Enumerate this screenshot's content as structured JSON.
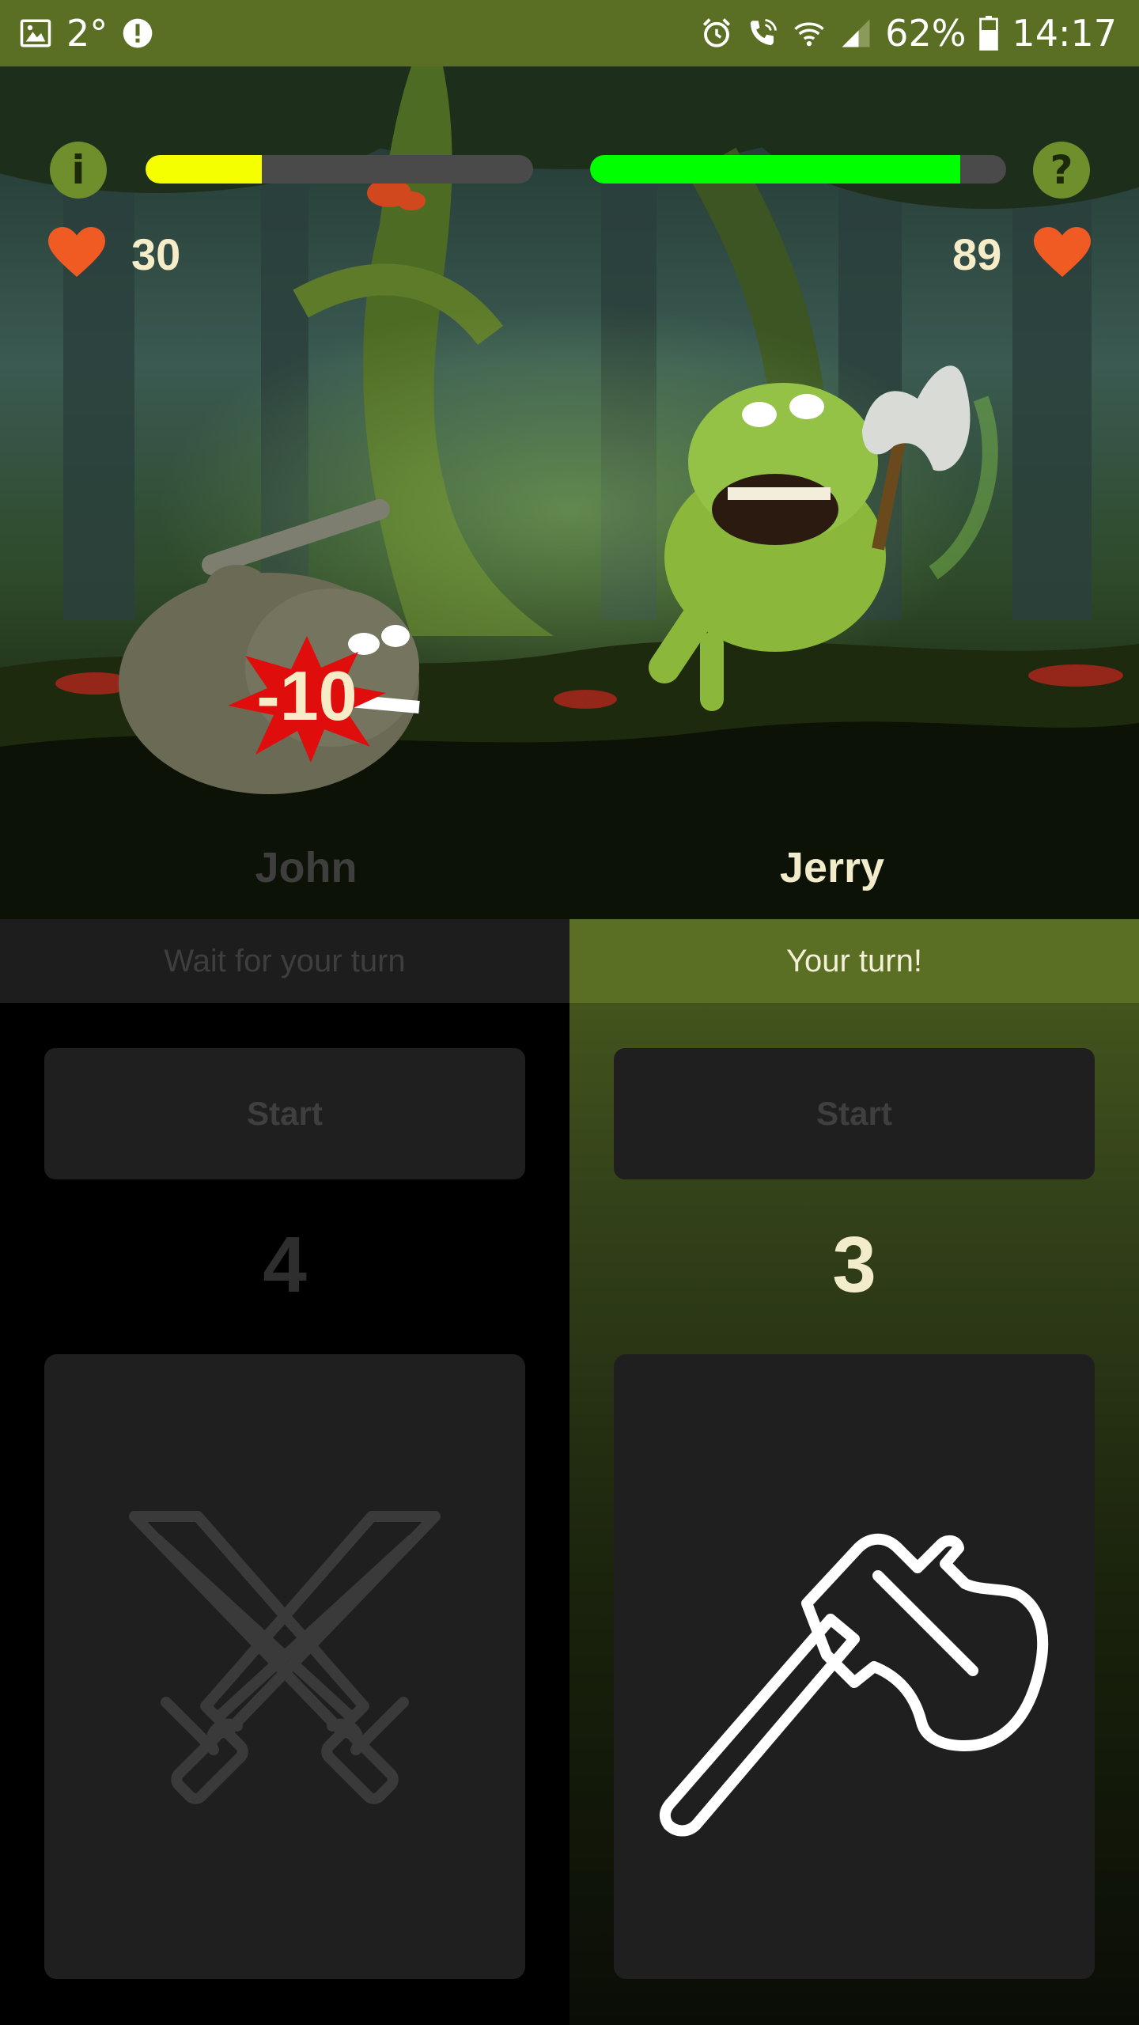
{
  "statusbar": {
    "temperature": "2°",
    "battery": "62%",
    "time": "14:17",
    "icons": [
      "image-icon",
      "alert-icon",
      "alarm-icon",
      "wifi-call-icon",
      "wifi-icon",
      "signal-icon",
      "battery-icon"
    ]
  },
  "hud": {
    "info_button": "i",
    "help_button": "?",
    "left_player": {
      "hp": "30",
      "hp_fraction": 0.3,
      "name": "John"
    },
    "right_player": {
      "hp": "89",
      "hp_fraction": 0.89,
      "name": "Jerry"
    },
    "damage_text": "-10"
  },
  "left_panel": {
    "banner": "Wait for your turn",
    "start_label": "Start",
    "counter": "4",
    "weapon_icon": "crossed-swords-icon"
  },
  "right_panel": {
    "banner": "Your turn!",
    "start_label": "Start",
    "counter": "3",
    "weapon_icon": "axe-icon"
  },
  "colors": {
    "accent": "#5a6f23",
    "left_hp": "#f5ff00",
    "right_hp": "#00ff00",
    "heart": "#f05a23",
    "active_text": "#f3ecca",
    "inactive_text": "#3e3e3e"
  }
}
